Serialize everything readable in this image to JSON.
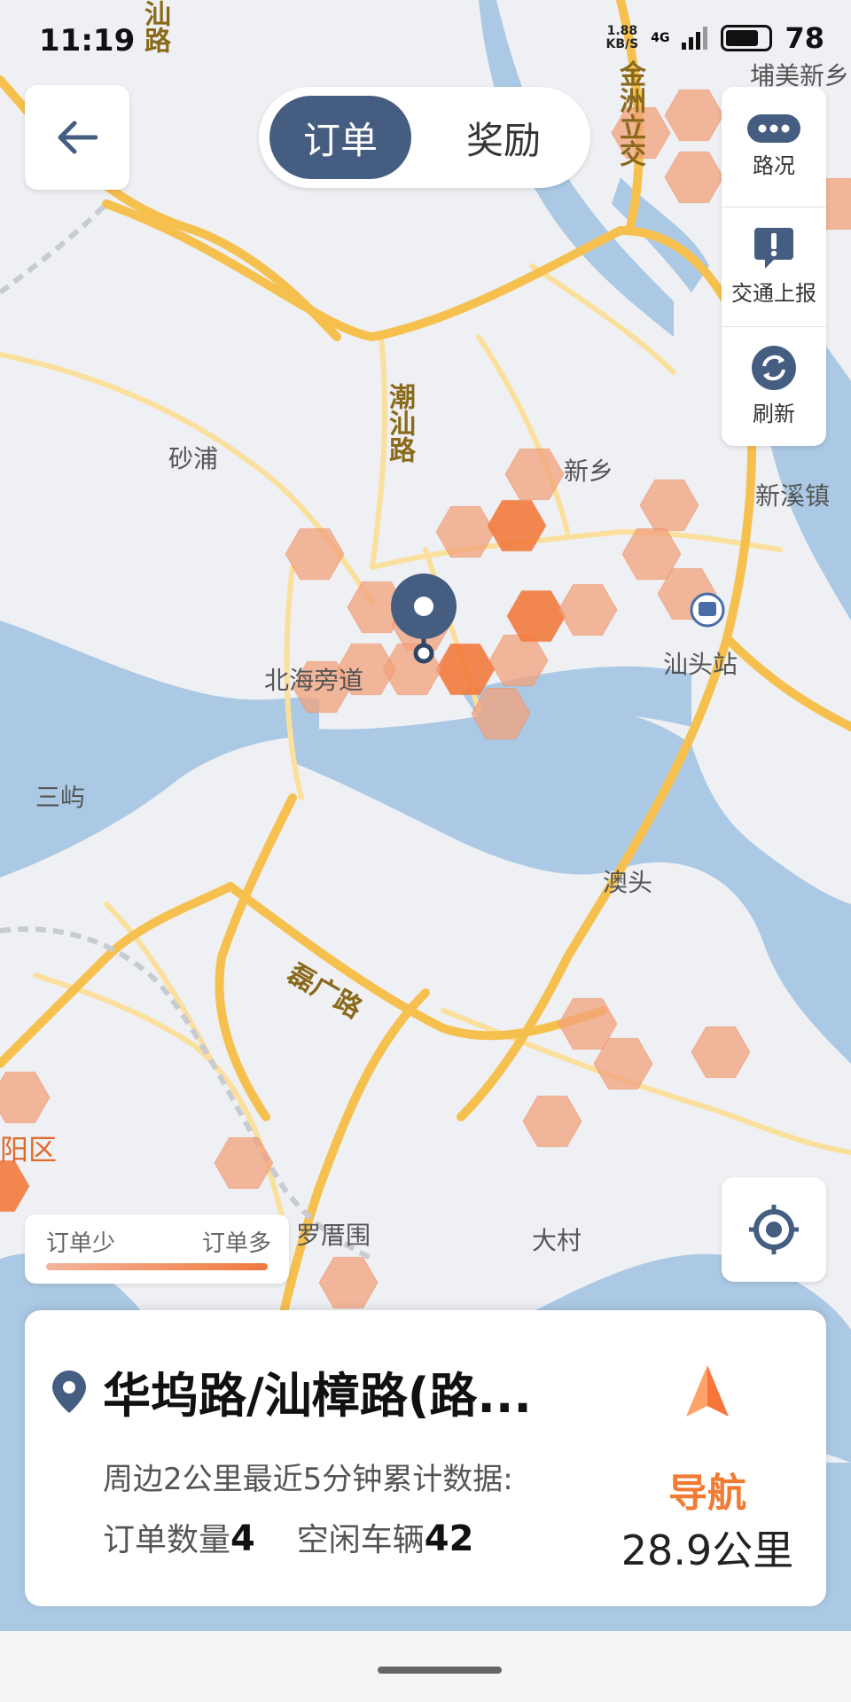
{
  "status_bar": {
    "time": "11:19",
    "net_speed_value": "1.88",
    "net_speed_unit": "KB/S",
    "network_type": "4G",
    "battery": "78"
  },
  "tabs": {
    "active": "订单",
    "inactive": "奖励"
  },
  "side_panel": {
    "traffic": "路况",
    "report": "交通上报",
    "refresh": "刷新"
  },
  "legend": {
    "low": "订单少",
    "high": "订单多"
  },
  "map_labels": {
    "jinzhou": "金洲立交",
    "puxinxiang": "埔美新乡",
    "shantoulu": "汕路",
    "chaoshanlu": "潮汕路",
    "shapu": "砂浦",
    "xinxiang": "新乡",
    "xinxizhen": "新溪镇",
    "beihai": "北海旁道",
    "shantouzhan": "汕头站",
    "sanyu": "三屿",
    "aotou": "澳头",
    "guanglu": "磊广路",
    "luotangwei": "罗厝围",
    "dacun": "大村",
    "district": "阳区"
  },
  "info": {
    "place": "华坞路/汕樟路(路...",
    "desc": "周边2公里最近5分钟累计数据:",
    "orders_label": "订单数量",
    "orders": "4",
    "vehicles_label": "空闲车辆",
    "vehicles": "42",
    "nav_label": "导航",
    "distance": "28.9公里"
  },
  "colors": {
    "accent": "#455d80",
    "nav": "#f27a32",
    "water": "#abc9e4",
    "land": "#eef0f4",
    "road_major": "#f6c04e",
    "road_minor": "#fbdf9c",
    "heat_low": "#f2a27c",
    "heat_high": "#f27a3d"
  },
  "icons": {
    "back": "arrow-left-icon",
    "traffic": "more-dots-icon",
    "report": "exclamation-bubble-icon",
    "refresh": "refresh-icon",
    "locate": "crosshair-icon",
    "pin": "location-pin-icon",
    "nav": "navigation-arrow-icon"
  }
}
